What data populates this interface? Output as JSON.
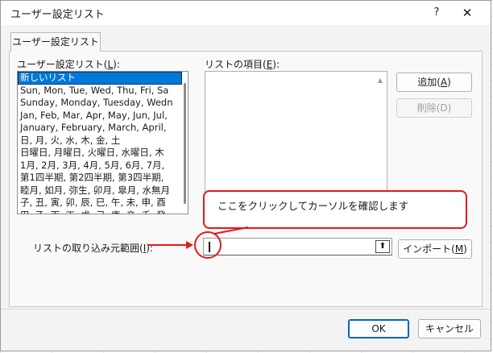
{
  "window": {
    "title": "ユーザー設定リスト",
    "help_glyph": "?",
    "close_glyph": "✕"
  },
  "tab": {
    "label": "ユーザー設定リスト"
  },
  "custom_lists": {
    "label_pre": "ユーザー設定リスト(",
    "label_key": "L",
    "label_post": "):",
    "items": [
      "新しいリスト",
      "Sun, Mon, Tue, Wed, Thu, Fri, Sa",
      "Sunday, Monday, Tuesday, Wedn",
      "Jan, Feb, Mar, Apr, May, Jun, Jul,",
      "January, February, March, April,",
      "日, 月, 火, 水, 木, 金, 土",
      "日曜日, 月曜日, 火曜日, 水曜日, 木",
      "1月, 2月, 3月, 4月, 5月, 6月, 7月,",
      "第1四半期, 第2四半期, 第3四半期,",
      "睦月, 如月, 弥生, 卯月, 皐月, 水無月",
      "子, 丑, 寅, 卯, 辰, 巳, 午, 未, 申, 酉",
      "甲, 乙, 丙, 丁, 戊, 己, 庚, 辛, 壬, 癸"
    ],
    "selected_index": 0
  },
  "list_entries": {
    "label_pre": "リストの項目(",
    "label_key": "E",
    "label_post": "):",
    "value": ""
  },
  "buttons": {
    "add_pre": "追加(",
    "add_key": "A",
    "add_post": ")",
    "delete_label": "削除(D)",
    "import_pre": "インポート(",
    "import_key": "M",
    "import_post": ")",
    "ok": "OK",
    "cancel": "キャンセル"
  },
  "import_range": {
    "label_pre": "リストの取り込み元範囲(",
    "label_key": "I",
    "label_post": "):",
    "value": "",
    "collapse_icon": "upload-arrow-icon"
  },
  "annotation": {
    "callout_text": "ここをクリックしてカーソルを確認します",
    "color": "#e11a1a"
  }
}
